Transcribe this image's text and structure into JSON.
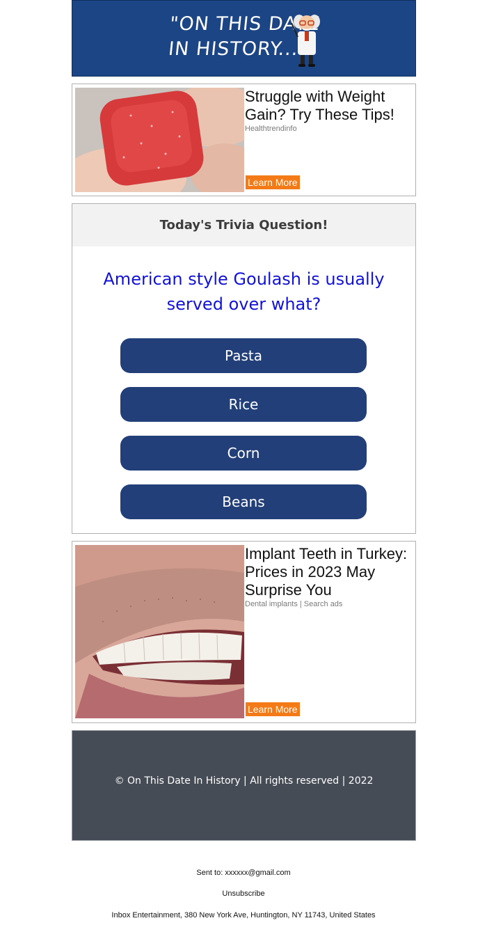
{
  "header": {
    "title_line1": "\"ON THIS DATE",
    "title_line2": "IN HISTORY...\""
  },
  "ads": [
    {
      "headline": "Struggle with Weight Gain? Try These Tips!",
      "source": "Healthtrendinfo",
      "button_label": "Learn More",
      "image": "red-gummy-candy-between-fingers"
    },
    {
      "headline": "Implant Teeth in Turkey: Prices in 2023 May Surprise You",
      "source": "Dental implants | Search ads",
      "button_label": "Learn More",
      "image": "smiling-mouth-white-teeth"
    }
  ],
  "trivia": {
    "heading": "Today's Trivia Question!",
    "question": "American style Goulash is usually served over what?",
    "answers": [
      "Pasta",
      "Rice",
      "Corn",
      "Beans"
    ]
  },
  "footer": {
    "copyright": "© On This Date In History | All rights reserved | 2022"
  },
  "meta": {
    "sent_to": "Sent to: xxxxxx@gmail.com",
    "unsubscribe": "Unsubscribe",
    "address": "Inbox Entertainment, 380 New York Ave, Huntington, NY 11743, United States"
  },
  "colors": {
    "banner": "#1b4584",
    "answer_button": "#223f7a",
    "question_text": "#1212d8",
    "ad_button": "#f37a16",
    "footer": "#464c55"
  }
}
